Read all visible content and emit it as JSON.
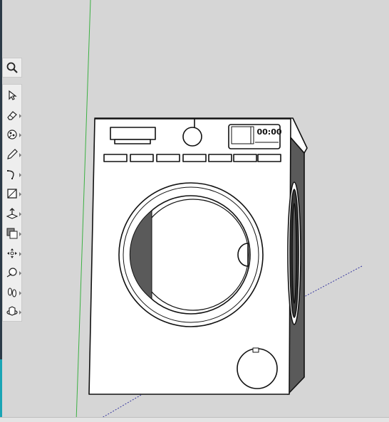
{
  "viewport": {
    "background_color": "#d6d6d6",
    "green_axis_color": "#3cb043",
    "blue_axis_color": "#3a3aa0"
  },
  "toolbar": {
    "tools": [
      {
        "name": "search-tool",
        "icon": "magnifier-icon"
      },
      {
        "name": "select-tool",
        "icon": "arrow-cursor-icon"
      },
      {
        "name": "eraser-tool",
        "icon": "eraser-icon"
      },
      {
        "name": "paint-bucket-tool",
        "icon": "paint-bucket-icon"
      },
      {
        "name": "pencil-line-tool",
        "icon": "pencil-icon"
      },
      {
        "name": "arc-tool",
        "icon": "arc-icon"
      },
      {
        "name": "rectangle-tool",
        "icon": "rectangle-icon"
      },
      {
        "name": "push-pull-tool",
        "icon": "push-pull-icon"
      },
      {
        "name": "offset-tool",
        "icon": "offset-icon"
      },
      {
        "name": "move-tool",
        "icon": "move-icon"
      },
      {
        "name": "tape-measure-tool",
        "icon": "tape-measure-icon"
      },
      {
        "name": "walk-tool",
        "icon": "footprints-icon"
      },
      {
        "name": "orbit-tool",
        "icon": "orbit-icon"
      }
    ]
  },
  "model": {
    "display_time": "00:00"
  }
}
